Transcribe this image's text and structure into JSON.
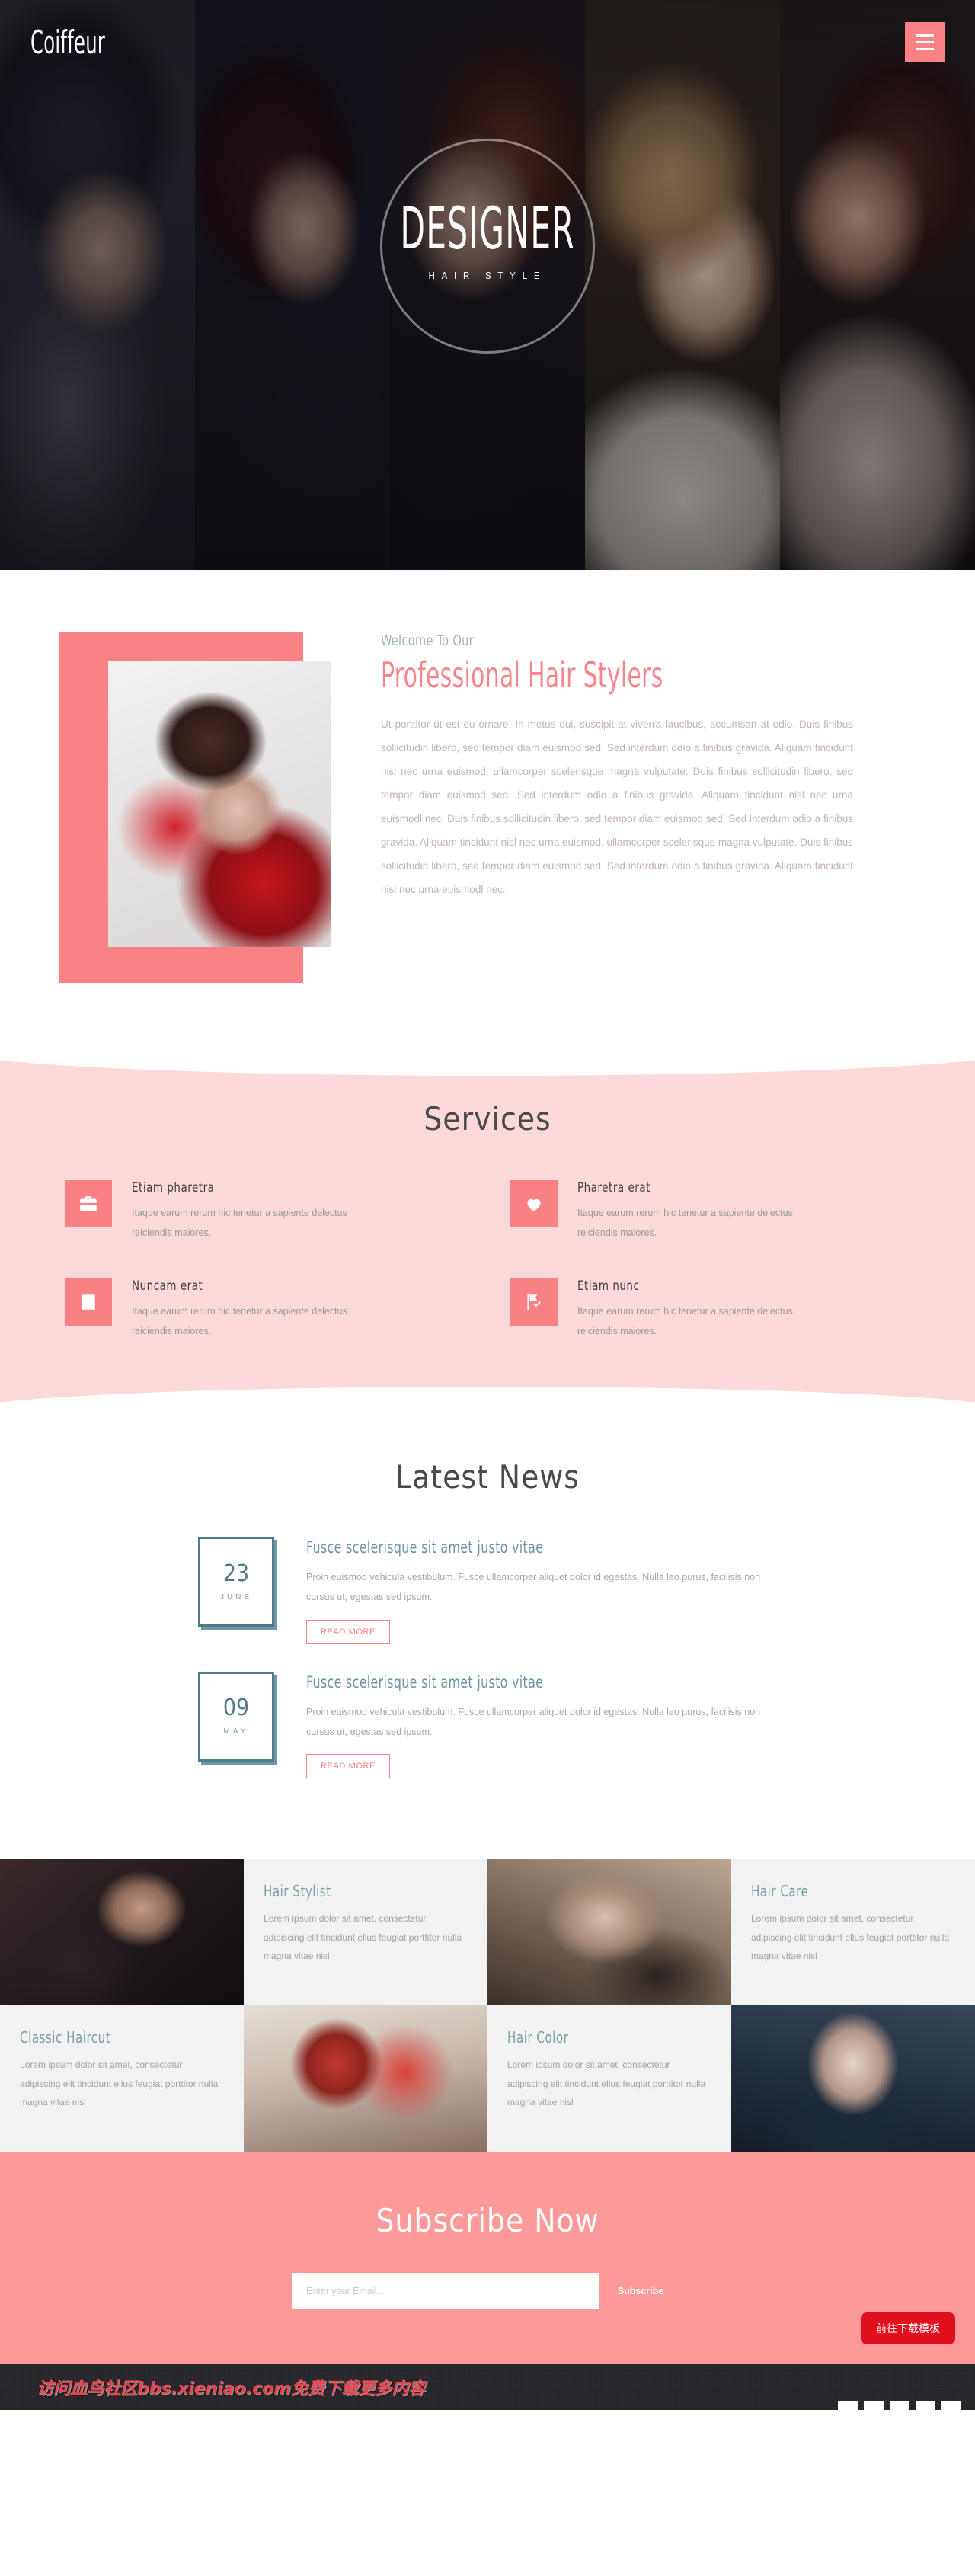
{
  "header": {
    "logo": "Coiffeur",
    "menu_icon": "hamburger-icon"
  },
  "hero": {
    "title": "DESIGNER",
    "subtitle": "HAIR STYLE"
  },
  "welcome": {
    "eyebrow": "Welcome To Our",
    "heading": "Professional Hair Stylers",
    "paragraph": "Ut porttitor ut est eu ornare. In metus dui, suscipit at viverra faucibus, accumsan at odio. Duis finibus sollicitudin libero, sed tempor diam euismod sed. Sed interdum odio a finibus gravida. Aliquam tincidunt nisl nec urna euismod, ullamcorper scelerisque magna vulputate. Duis finibus sollicitudin libero, sed tempor diam euismod sed. Sed interdum odio a finibus gravida. Aliquam tincidunt nisl nec urna euismodl nec. Duis finibus sollicitudin libero, sed tempor diam euismod sed. Sed interdum odio a finibus gravida. Aliquam tincidunt nisl nec urna euismod, ullamcorper scelerisque magna vulputate. Duis finibus sollicitudin libero, sed tempor diam euismod sed. Sed interdum odio a finibus gravida. Aliquam tincidunt nisl nec urna euismodl nec."
  },
  "services": {
    "title": "Services",
    "items": [
      {
        "icon": "briefcase-icon",
        "title": "Etiam pharetra",
        "text": "Itaque earum rerum hic tenetur a sapiente delectus reiciendis maiores."
      },
      {
        "icon": "heart-icon",
        "title": "Pharetra erat",
        "text": "Itaque earum rerum hic tenetur a sapiente delectus reiciendis maiores."
      },
      {
        "icon": "check-square-icon",
        "title": "Nuncam erat",
        "text": "Itaque earum rerum hic tenetur a sapiente delectus reiciendis maiores."
      },
      {
        "icon": "flag-check-icon",
        "title": "Etiam nunc",
        "text": "Itaque earum rerum hic tenetur a sapiente delectus reiciendis maiores."
      }
    ]
  },
  "news": {
    "title": "Latest News",
    "items": [
      {
        "day": "23",
        "month": "JUNE",
        "title": "Fusce scelerisque sit amet justo vitae",
        "text": "Proin euismod vehicula vestibulum. Fusce ullamcorper aliquet dolor id egestas. Nulla leo purus, facilisis non cursus ut, egestas sed ipsum.",
        "button": "READ MORE"
      },
      {
        "day": "09",
        "month": "MAY",
        "title": "Fusce scelerisque sit amet justo vitae",
        "text": "Proin euismod vehicula vestibulum. Fusce ullamcorper aliquet dolor id egestas. Nulla leo purus, facilisis non cursus ut, egestas sed ipsum.",
        "button": "READ MORE"
      }
    ]
  },
  "gallery": {
    "items": [
      {
        "type": "image",
        "name": "barber-shaving-photo"
      },
      {
        "type": "text",
        "title": "Hair Stylist",
        "text": "Lorem ipsum dolor sit amet, consectetur adipiscing elit tincidunt ellus feugiat porttitor nulla magna vitae nisl"
      },
      {
        "type": "image",
        "name": "haircut-clipper-photo"
      },
      {
        "type": "text",
        "title": "Hair Care",
        "text": "Lorem ipsum dolor sit amet, consectetur adipiscing elit tincidunt ellus feugiat porttitor nulla magna vitae nisl"
      },
      {
        "type": "text",
        "title": "Classic Haircut",
        "text": "Lorem ipsum dolor sit amet, consectetur adipiscing elit tincidunt ellus feugiat porttitor nulla magna vitae nisl"
      },
      {
        "type": "image",
        "name": "two-women-red-photo"
      },
      {
        "type": "text",
        "title": "Hair Color",
        "text": "Lorem ipsum dolor sit amet, consectetur adipiscing elit tincidunt ellus feugiat porttitor nulla magna vitae nisl"
      },
      {
        "type": "image",
        "name": "blonde-portrait-photo"
      }
    ]
  },
  "subscribe": {
    "title": "Subscribe Now",
    "placeholder": "Enter your Email...",
    "value": "",
    "button": "Subscribe"
  },
  "watermark": {
    "text": "访问血鸟社区bbs.xieniao.com免费下载更多内容",
    "download_button": "前往下载模板"
  },
  "colors": {
    "accent": "#fa8285",
    "accent_soft": "#fc9a9a",
    "services_bg": "#fdd9d9",
    "teal": "#4e7c88",
    "teal_light": "#7ba0a9",
    "watermark_red": "#e8444e",
    "download_red": "#e0101f"
  }
}
